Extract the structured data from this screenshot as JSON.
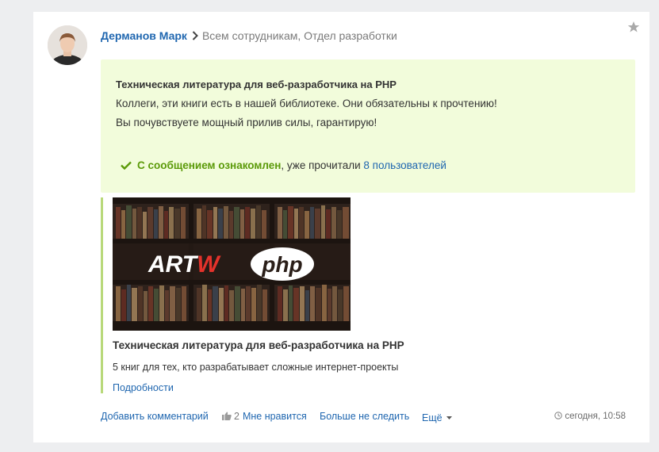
{
  "post": {
    "author": "Дерманов Марк",
    "recipients": "Всем сотрудникам, Отдел разработки",
    "notice": {
      "title": "Техническая литература для веб-разработчика на PHP",
      "line1": "Коллеги, эти книги есть в нашей библиотеке. Они обязательны к прочтению!",
      "line2": "Вы почувствуете мощный прилив силы, гарантирую!"
    },
    "ack": {
      "label": "С сообщением ознакомлен",
      "middle": ", уже прочитали ",
      "link": "8 пользователей"
    },
    "attachment": {
      "logo_left": "ART",
      "logo_accent": "W",
      "logo_right": "php",
      "title": "Техническая литература для веб-разработчика на PHP",
      "description": "5 книг для тех, кто разрабатывает сложные интернет-проекты",
      "more_link": "Подробности"
    },
    "footer": {
      "comment": "Добавить комментарий",
      "like_count": "2",
      "like": "Мне нравится",
      "unfollow": "Больше не следить",
      "more": "Ещё",
      "time": "сегодня, 10:58"
    }
  },
  "colors": {
    "link": "#2067b0",
    "notice_bg": "#f2fcdb",
    "ack_green": "#5b9a09",
    "logo_accent": "#e4322b",
    "attachment_border": "#b8d97a"
  },
  "icons": [
    "avatar",
    "chevron-right-icon",
    "star-icon",
    "check-icon",
    "like-icon",
    "caret-down-icon",
    "clock-icon"
  ]
}
